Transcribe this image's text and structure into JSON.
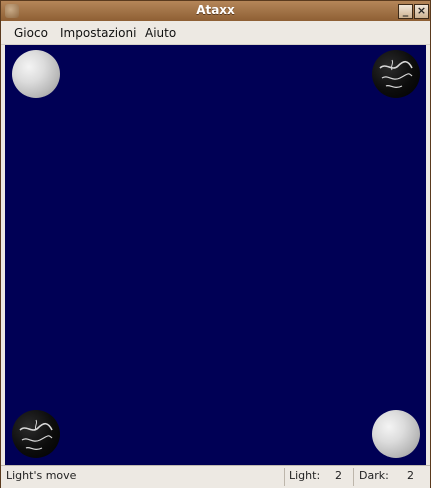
{
  "window": {
    "title": "Ataxx"
  },
  "menu": {
    "items": [
      "Gioco",
      "Impostazioni",
      "Aiuto"
    ]
  },
  "status": {
    "message": "Light's move",
    "light_label": "Light:",
    "light_score": "2",
    "dark_label": "Dark:",
    "dark_score": "2"
  },
  "board": {
    "colors": {
      "background": "#000055",
      "light_piece": "#d8d8d8",
      "dark_piece": "#000000"
    },
    "pieces": [
      {
        "color": "light",
        "corner": "top-left"
      },
      {
        "color": "dark",
        "corner": "top-right"
      },
      {
        "color": "dark",
        "corner": "bottom-left"
      },
      {
        "color": "light",
        "corner": "bottom-right"
      }
    ]
  }
}
